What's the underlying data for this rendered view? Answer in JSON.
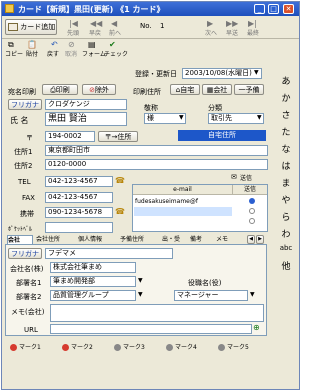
{
  "window": {
    "title": "カード【新規】黒田(更新) 《1 カード》"
  },
  "toolbar1": {
    "add_card": "カード追加",
    "nav_first": "先頭",
    "nav_prev_page": "早戻",
    "nav_prev": "前へ",
    "no_label": "No.",
    "no_value": "1",
    "nav_next": "次へ",
    "nav_next_page": "早送",
    "nav_last": "最終"
  },
  "toolbar2": {
    "copy": "コピー",
    "paste": "貼付",
    "undo": "戻す",
    "cancel": "取消",
    "form": "フォーム",
    "check": "チェック"
  },
  "reg": {
    "label": "登録・更新日",
    "value": "2003/10/08(水曜日)"
  },
  "print": {
    "label": "宛名印刷",
    "print_btn": "印刷",
    "exclude_btn": "除外"
  },
  "print_place": {
    "label": "印刷住所",
    "home": "自宅",
    "company": "会社",
    "other": "一予備"
  },
  "name": {
    "furigana_btn": "フリガナ",
    "furigana": "クロダケンジ",
    "label": "氏 名",
    "value": "黒田 賢治"
  },
  "title_field": {
    "label": "敬称",
    "value": "様"
  },
  "category": {
    "label": "分類",
    "value": "取引先"
  },
  "postal": {
    "label": "〒",
    "value": "194-0002",
    "btn": "〒→住所"
  },
  "address_type": "自宅住所",
  "address1": {
    "label": "住所1",
    "value": "東京都町田市"
  },
  "address2": {
    "label": "住所2",
    "value": "0120-0000"
  },
  "tel": {
    "label": "TEL",
    "value": "042-123-4567"
  },
  "fax": {
    "label": "FAX",
    "value": "042-123-4567"
  },
  "mobile": {
    "label": "携帯",
    "value": "090-1234-5678"
  },
  "pager": {
    "label": "ﾎﾟｹｯﾄﾍﾞﾙ"
  },
  "email": {
    "header": "e-mail",
    "send_header": "送信",
    "rows": [
      "fudesakuseimame@f",
      "",
      ""
    ]
  },
  "mail_send_label": "送信",
  "kana_index": [
    "あ",
    "か",
    "さ",
    "た",
    "な",
    "は",
    "ま",
    "や",
    "ら",
    "わ",
    "abc",
    "他"
  ],
  "tabs": [
    "会社",
    "会社住所",
    "個人情報",
    "予備住所",
    "出・受",
    "備考",
    "メモ"
  ],
  "company": {
    "furigana_btn": "フリガナ",
    "furigana": "フデマメ",
    "name_label": "会社名(株)",
    "name_value": "株式会社筆まめ",
    "dept1_label": "部署名1",
    "dept1_value": "筆まめ開発部",
    "dept2_label": "部署名2",
    "dept2_value": "品質管理グループ",
    "position_label": "役職名(役)",
    "position_value": "マネージャー",
    "memo_label": "メモ(会社)",
    "url_label": "URL"
  },
  "marks": [
    {
      "label": "マーク1",
      "color": "#d63a2e"
    },
    {
      "label": "マーク2",
      "color": "#d63a2e"
    },
    {
      "label": "マーク3",
      "color": "#888888"
    },
    {
      "label": "マーク4",
      "color": "#888888"
    },
    {
      "label": "マーク5",
      "color": "#888888"
    }
  ]
}
